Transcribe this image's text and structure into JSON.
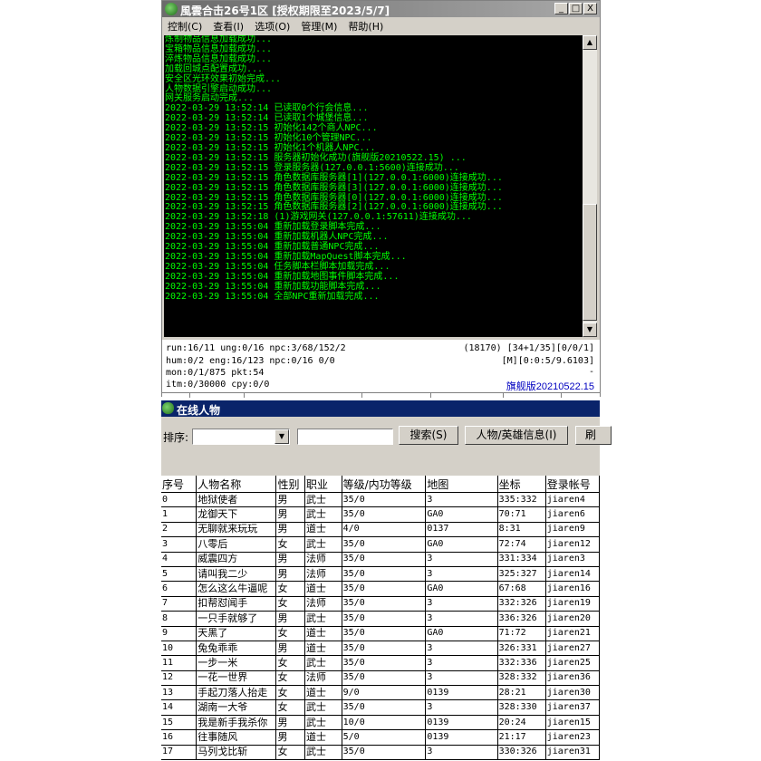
{
  "window": {
    "title": "風雲合击26号1区 [授权期限至2023/5/7]",
    "controls": [
      "_",
      "□",
      "X"
    ],
    "menu": [
      "控制(C)",
      "查看(I)",
      "选项(O)",
      "管理(M)",
      "帮助(H)"
    ]
  },
  "console": {
    "lines": [
      "炼制物品信息加载成功...",
      "宝箱物品信息加载成功...",
      "淬炼物品信息加载成功...",
      "加载回城点配置成功...",
      "安全区光环效果初始完成...",
      "人物数据引擎启动成功...",
      "网关服务启动完成...",
      "2022-03-29 13:52:14 已读取0个行会信息...",
      "2022-03-29 13:52:14 已读取1个城堡信息...",
      "2022-03-29 13:52:15 初始化142个商人NPC...",
      "2022-03-29 13:52:15 初始化10个管理NPC...",
      "2022-03-29 13:52:15 初始化1个机器人NPC...",
      "2022-03-29 13:52:15 服务器初始化成功(旗舰版20210522.15) ...",
      "2022-03-29 13:52:15 登录服务器(127.0.0.1:5600)连接成功...",
      "2022-03-29 13:52:15 角色数据库服务器[1](127.0.0.1:6000)连接成功...",
      "2022-03-29 13:52:15 角色数据库服务器[3](127.0.0.1:6000)连接成功...",
      "2022-03-29 13:52:15 角色数据库服务器[0](127.0.0.1:6000)连接成功...",
      "2022-03-29 13:52:15 角色数据库服务器[2](127.0.0.1:6000)连接成功...",
      "2022-03-29 13:52:18 (1)游戏网关(127.0.0.1:57611)连接成功...",
      "2022-03-29 13:55:04 重新加载登录脚本完成...",
      "2022-03-29 13:55:04 重新加载机器人NPC完成...",
      "2022-03-29 13:55:04 重新加载普通NPC完成...",
      "2022-03-29 13:55:04 重新加载MapQuest脚本完成...",
      "2022-03-29 13:55:04 任务脚本栏脚本加载完成...",
      "2022-03-29 13:55:04 重新加载地图事件脚本完成...",
      "2022-03-29 13:55:04 重新加载功能脚本完成...",
      "2022-03-29 13:55:04 全部NPC重新加载完成..."
    ]
  },
  "stats": {
    "line1": "run:16/11 ung:0/16 npc:3/68/152/2",
    "line2": "hum:0/2 eng:16/123 npc:0/16 0/0",
    "line3": "mon:0/1/875 pkt:54",
    "line4": "itm:0/30000 cpy:0/0",
    "right1": "(18170) [34+1/35][0/0/1]",
    "right2": "[M][0:0:5/9.6103]",
    "right3": "-",
    "version": "旗舰版20210522.15"
  },
  "online": {
    "title": "在线人物",
    "sort_label": "排序:",
    "search_button": "搜索(S)",
    "info_button": "人物/英雄信息(I)",
    "refresh_button": "刷",
    "columns": [
      "序号",
      "人物名称",
      "性别",
      "职业",
      "等级/内功等级",
      "地图",
      "坐标",
      "登录帐号"
    ],
    "rows": [
      [
        "0",
        "地狱使者",
        "男",
        "武士",
        "35/0",
        "3",
        "335:332",
        "jiaren4"
      ],
      [
        "1",
        "龙御天下",
        "男",
        "武士",
        "35/0",
        "GA0",
        "70:71",
        "jiaren6"
      ],
      [
        "2",
        "无聊就来玩玩",
        "男",
        "道士",
        "4/0",
        "0137",
        "8:31",
        "jiaren9"
      ],
      [
        "3",
        "八零后",
        "女",
        "武士",
        "35/0",
        "GA0",
        "72:74",
        "jiaren12"
      ],
      [
        "4",
        "威震四方",
        "男",
        "法师",
        "35/0",
        "3",
        "331:334",
        "jiaren3"
      ],
      [
        "5",
        "请叫我二少",
        "男",
        "法师",
        "35/0",
        "3",
        "325:327",
        "jiaren14"
      ],
      [
        "6",
        "怎么这么牛逼呢",
        "女",
        "道士",
        "35/0",
        "GA0",
        "67:68",
        "jiaren16"
      ],
      [
        "7",
        "扣帮怼闻手",
        "女",
        "法师",
        "35/0",
        "3",
        "332:326",
        "jiaren19"
      ],
      [
        "8",
        "一只手就够了",
        "男",
        "武士",
        "35/0",
        "3",
        "336:326",
        "jiaren20"
      ],
      [
        "9",
        "天黑了",
        "女",
        "道士",
        "35/0",
        "GA0",
        "71:72",
        "jiaren21"
      ],
      [
        "10",
        "兔兔乖乖",
        "男",
        "道士",
        "35/0",
        "3",
        "326:331",
        "jiaren27"
      ],
      [
        "11",
        "一步一米",
        "女",
        "武士",
        "35/0",
        "3",
        "332:336",
        "jiaren25"
      ],
      [
        "12",
        "一花一世界",
        "女",
        "法师",
        "35/0",
        "3",
        "328:332",
        "jiaren36"
      ],
      [
        "13",
        "手起刀落人抬走",
        "女",
        "道士",
        "9/0",
        "0139",
        "28:21",
        "jiaren30"
      ],
      [
        "14",
        "湖南一大爷",
        "女",
        "武士",
        "35/0",
        "3",
        "328:330",
        "jiaren37"
      ],
      [
        "15",
        "我是新手我杀你",
        "男",
        "武士",
        "10/0",
        "0139",
        "20:24",
        "jiaren15"
      ],
      [
        "16",
        "往事随风",
        "男",
        "道士",
        "5/0",
        "0139",
        "21:17",
        "jiaren23"
      ],
      [
        "17",
        "马列戈比斩",
        "女",
        "武士",
        "35/0",
        "3",
        "330:326",
        "jiaren31"
      ]
    ]
  }
}
